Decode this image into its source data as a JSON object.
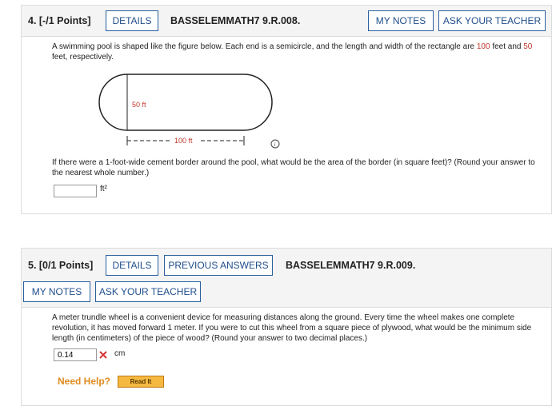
{
  "q4": {
    "number": "4. [-/1 Points]",
    "details_label": "DETAILS",
    "code": "BASSELEMMATH7 9.R.008.",
    "my_notes_label": "MY NOTES",
    "ask_teacher_label": "ASK YOUR TEACHER",
    "text_pre": "A swimming pool is shaped like the figure below. Each end is a semicircle, and the length and width of the rectangle are ",
    "length_value": "100",
    "text_mid": " feet and ",
    "width_value": "50",
    "text_post": " feet, respectively.",
    "width_label": "50 ft",
    "length_label": "100 ft",
    "question_text": "If there were a 1-foot-wide cement border around the pool, what would be the area of the border (in square feet)? (Round your answer to the nearest whole number.)",
    "answer_value": "",
    "unit": "ft²"
  },
  "q5": {
    "number": "5. [0/1 Points]",
    "details_label": "DETAILS",
    "previous_answers_label": "PREVIOUS ANSWERS",
    "code": "BASSELEMMATH7 9.R.009.",
    "my_notes_label": "MY NOTES",
    "ask_teacher_label": "ASK YOUR TEACHER",
    "question_text": "A meter trundle wheel is a convenient device for measuring distances along the ground. Every time the wheel makes one complete revolution, it has moved forward 1 meter. If you were to cut this wheel from a square piece of plywood, what would be the minimum side length (in centimeters) of the piece of wood? (Round your answer to two decimal places.)",
    "answer_value": "0.14",
    "unit": "cm",
    "need_help_label": "Need Help?",
    "read_it_label": "Read It"
  }
}
